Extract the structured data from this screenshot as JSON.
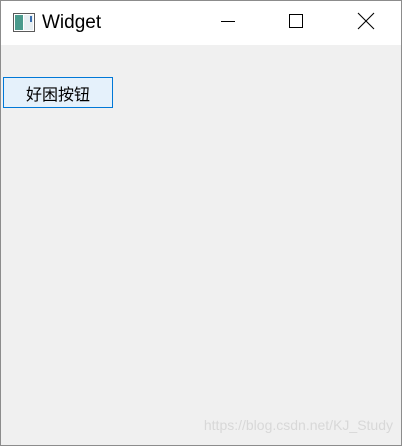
{
  "window": {
    "title": "Widget",
    "icon": "qt-widget-app-icon",
    "controls": {
      "minimize_icon": "minimize-icon",
      "maximize_icon": "maximize-icon",
      "close_icon": "close-icon"
    }
  },
  "content": {
    "button_label": "好困按钮"
  },
  "watermark": {
    "text": "https://blog.csdn.net/KJ_Study"
  },
  "colors": {
    "titlebar": "#ffffff",
    "client_background": "#f0f0f0",
    "button_fill": "#e5f1fb",
    "button_border": "#0078d7"
  }
}
